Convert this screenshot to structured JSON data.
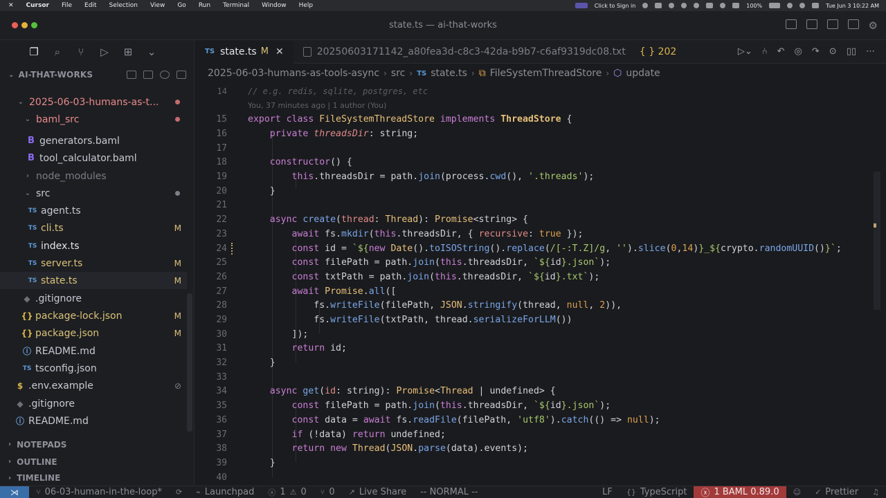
{
  "menubar": {
    "apple": "",
    "items": [
      "Cursor",
      "File",
      "Edit",
      "Selection",
      "View",
      "Go",
      "Run",
      "Terminal",
      "Window",
      "Help"
    ],
    "sign_in": "Click to Sign in",
    "battery": "100%",
    "datetime": "Tue Jun 3  10:22 AM"
  },
  "window": {
    "title": "state.ts — ai-that-works"
  },
  "explorer": {
    "root": "AI-THAT-WORKS",
    "rows": [
      {
        "label": "2025-06-03-humans-as-t...",
        "kind": "folder"
      },
      {
        "label": "baml_src",
        "kind": "folder"
      },
      {
        "label": "generators.baml",
        "kind": "baml"
      },
      {
        "label": "tool_calculator.baml",
        "kind": "baml"
      },
      {
        "label": "node_modules",
        "kind": "folder-dim"
      },
      {
        "label": "src",
        "kind": "folder"
      },
      {
        "label": "agent.ts",
        "kind": "ts"
      },
      {
        "label": "cli.ts",
        "kind": "ts",
        "status": "M"
      },
      {
        "label": "index.ts",
        "kind": "ts"
      },
      {
        "label": "server.ts",
        "kind": "ts",
        "status": "M"
      },
      {
        "label": "state.ts",
        "kind": "ts",
        "status": "M"
      },
      {
        "label": ".gitignore",
        "kind": "git"
      },
      {
        "label": "package-lock.json",
        "kind": "json",
        "status": "M"
      },
      {
        "label": "package.json",
        "kind": "json",
        "status": "M"
      },
      {
        "label": "README.md",
        "kind": "info"
      },
      {
        "label": "tsconfig.json",
        "kind": "tsconfig"
      },
      {
        "label": ".env.example",
        "kind": "env"
      },
      {
        "label": ".gitignore",
        "kind": "git"
      },
      {
        "label": "README.md",
        "kind": "info"
      }
    ],
    "file_icon_ts": "TS",
    "file_icon_baml": "B",
    "file_icon_json": "{}",
    "file_icon_info": "ⓘ",
    "file_icon_git": "◆",
    "file_icon_env": "$",
    "sections": [
      "NOTEPADS",
      "OUTLINE",
      "TIMELINE"
    ]
  },
  "tabs": {
    "active": {
      "icon": "TS",
      "label": "state.ts",
      "status": "M"
    },
    "other": {
      "label": "20250603171142_a80fea3d-c8c3-42da-b9b7-c6af9319dc08.txt"
    },
    "overflow": "{ } 202"
  },
  "breadcrumbs": {
    "items": [
      "2025-06-03-humans-as-tools-async",
      "src"
    ],
    "file_icon": "TS",
    "file": "state.ts",
    "class": "FileSystemThreadStore",
    "method": "update"
  },
  "editor": {
    "partial_line_number": "14",
    "partial_comment": "// e.g. redis, sqlite, postgres, etc",
    "blame": "You, 37 minutes ago | 1 author (You)",
    "line_numbers": [
      "15",
      "16",
      "17",
      "18",
      "19",
      "20",
      "21",
      "22",
      "23",
      "24",
      "25",
      "26",
      "27",
      "28",
      "29",
      "30",
      "31",
      "32",
      "33",
      "34",
      "35",
      "36",
      "37",
      "38",
      "39",
      "40"
    ]
  },
  "statusbar": {
    "branch": "06-03-human-in-the-loop*",
    "launchpad": "Launchpad",
    "errors": "1",
    "warnings": "0",
    "ports": "0",
    "liveshare": "Live Share",
    "mode": "-- NORMAL --",
    "eol": "LF",
    "language": "TypeScript",
    "baml": "1 BAML 0.89.0",
    "prettier": "Prettier"
  },
  "colors": {
    "accent": "#3a6ea8",
    "error": "#a33a3a",
    "modified": "#d9c278"
  }
}
